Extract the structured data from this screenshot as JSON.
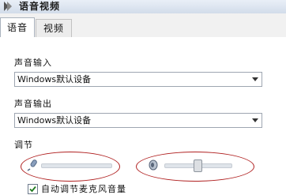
{
  "window": {
    "title": "语音视频"
  },
  "tabs": [
    {
      "label": "语音",
      "active": true
    },
    {
      "label": "视频",
      "active": false
    }
  ],
  "voice_input": {
    "label": "声音输入",
    "selected": "Windows默认设备"
  },
  "voice_output": {
    "label": "声音输出",
    "selected": "Windows默认设备"
  },
  "adjust": {
    "label": "调节",
    "microphone_level": 0.0,
    "speaker_level": 0.5
  },
  "auto_adjust": {
    "label": "自动调节麦克风音量",
    "checked": true
  },
  "colors": {
    "highlight_oval": "#b02020",
    "title_gradient_top": "#e9eff7"
  },
  "icons": {
    "app": "app-logo-icon",
    "mic": "microphone-icon",
    "speaker": "speaker-icon",
    "check": "checkmark-icon"
  }
}
